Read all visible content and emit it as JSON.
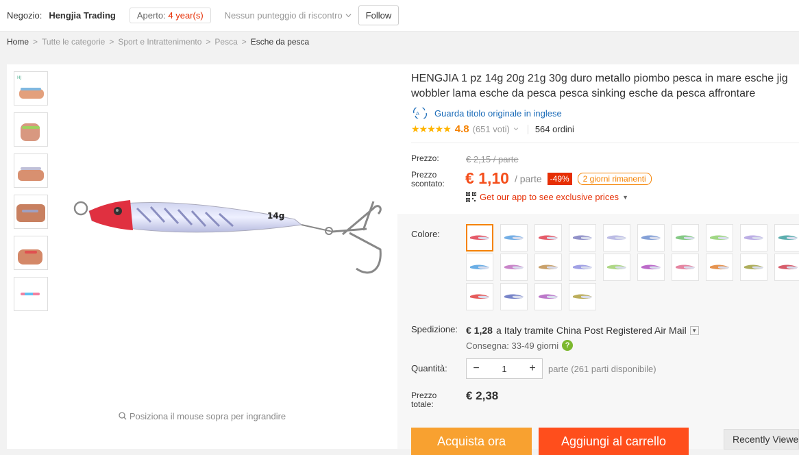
{
  "store": {
    "label": "Negozio:",
    "name": "Hengjia Trading",
    "open_label": "Aperto:",
    "open_years": "4 year(s)",
    "feedback": "Nessun punteggio di riscontro",
    "follow": "Follow"
  },
  "breadcrumb": [
    "Home",
    "Tutte le categorie",
    "Sport e Intrattenimento",
    "Pesca",
    "Esche da pesca"
  ],
  "gallery": {
    "zoom_hint": "Posiziona il mouse sopra per ingrandire",
    "lure_weight": "14g"
  },
  "product": {
    "title": "HENGJIA 1 pz 14g 20g 21g 30g duro metallo piombo pesca in mare esche jig wobbler lama esche da pesca pesca sinking esche da pesca affrontare",
    "original_title_link": "Guarda titolo originale in inglese",
    "rating": "4.8",
    "votes": "(651 voti)",
    "orders": "564 ordini",
    "stars": "★★★★★"
  },
  "price": {
    "label": "Prezzo:",
    "original": "€ 2,15 / parte",
    "discount_label_1": "Prezzo",
    "discount_label_2": "scontato:",
    "current": "€ 1,10",
    "unit": "/ parte",
    "discount": "-49%",
    "days_left": "2 giorni rimanenti",
    "app_promo": "Get our app to see exclusive prices"
  },
  "options": {
    "color_label": "Colore:",
    "colors": [
      "#e04050",
      "#5aa0e0",
      "#e04050",
      "#7f7fc0",
      "#b0b0e0",
      "#7090d0",
      "#70c070",
      "#90d070",
      "#b0a0e0",
      "#40a0a0",
      "#50a0e0",
      "#c070c0",
      "#c09050",
      "#9090e0",
      "#a0d070",
      "#b050c0",
      "#e07090",
      "#e08030",
      "#a0a040",
      "#d04050",
      "#e04040",
      "#6070c0",
      "#b060c0",
      "#b0a040"
    ]
  },
  "shipping": {
    "label": "Spedizione:",
    "cost": "€ 1,28",
    "method": "a Italy tramite China Post Registered Air Mail",
    "delivery": "Consegna: 33-49 giorni"
  },
  "quantity": {
    "label": "Quantità:",
    "value": "1",
    "available": "parte (261 parti disponibile)"
  },
  "total": {
    "label_1": "Prezzo",
    "label_2": "totale:",
    "value": "€ 2,38"
  },
  "actions": {
    "buy_now": "Acquista ora",
    "add_to_cart": "Aggiungi al carrello",
    "recently_viewed": "Recently Viewed"
  }
}
